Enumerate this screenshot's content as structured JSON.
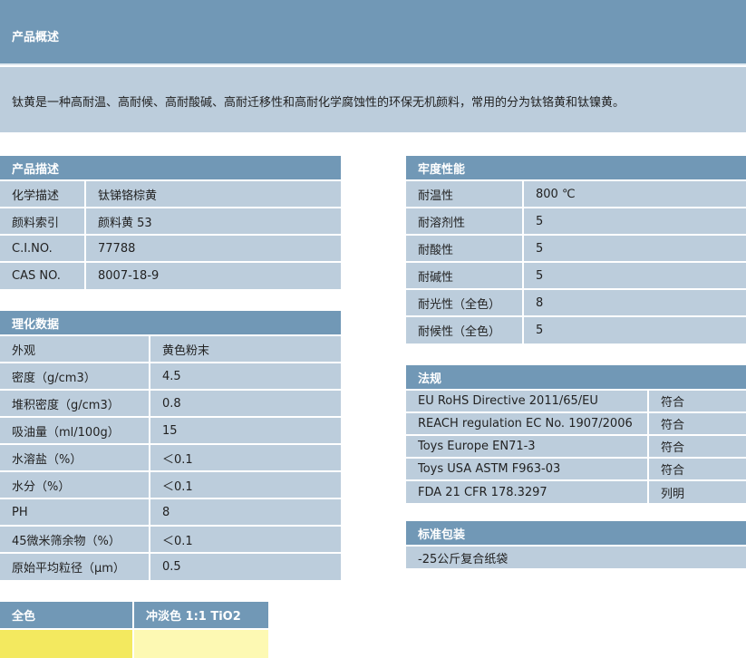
{
  "overview": {
    "title": "产品概述",
    "text": "钛黄是一种高耐温、高耐候、高耐酸碱、高耐迁移性和高耐化学腐蚀性的环保无机颜料，常用的分为钛铬黄和钛镍黄。"
  },
  "description": {
    "title": "产品描述",
    "rows": [
      [
        "化学描述",
        "钛锑铬棕黄"
      ],
      [
        "颜料索引",
        "颜料黄 53"
      ],
      [
        "C.I.NO.",
        "77788"
      ],
      [
        "CAS NO.",
        "8007-18-9"
      ]
    ]
  },
  "physchem": {
    "title": "理化数据",
    "rows": [
      [
        "外观",
        "黄色粉末"
      ],
      [
        "密度（g/cm3）",
        "4.5"
      ],
      [
        "堆积密度（g/cm3）",
        "0.8"
      ],
      [
        "吸油量（ml/100g）",
        "15"
      ],
      [
        "水溶盐（%）",
        "＜0.1"
      ],
      [
        "水分（%）",
        "＜0.1"
      ],
      [
        "PH",
        "8"
      ],
      [
        "45微米筛余物（%）",
        "＜0.1"
      ],
      [
        "原始平均粒径（μm）",
        "0.5"
      ]
    ]
  },
  "fastness": {
    "title": "牢度性能",
    "rows": [
      [
        "耐温性",
        "800 ℃"
      ],
      [
        "耐溶剂性",
        "5"
      ],
      [
        "耐酸性",
        "5"
      ],
      [
        "耐碱性",
        "5"
      ],
      [
        "耐光性（全色）",
        "8"
      ],
      [
        "耐候性（全色）",
        "5"
      ]
    ]
  },
  "regulations": {
    "title": "法规",
    "rows": [
      [
        "EU RoHS Directive 2011/65/EU",
        "符合"
      ],
      [
        "REACH regulation EC No. 1907/2006",
        "符合"
      ],
      [
        "Toys Europe EN71-3",
        "符合"
      ],
      [
        "Toys USA ASTM F963-03",
        "符合"
      ],
      [
        "FDA 21 CFR 178.3297",
        "列明"
      ]
    ]
  },
  "packaging": {
    "title": "标准包装",
    "text": "-25公斤复合纸袋"
  },
  "colors": {
    "full_label": "全色",
    "tint_label": "冲淡色 1:1 TiO2",
    "full_color": "#f3e95f",
    "tint_color": "#fdf9b3"
  }
}
